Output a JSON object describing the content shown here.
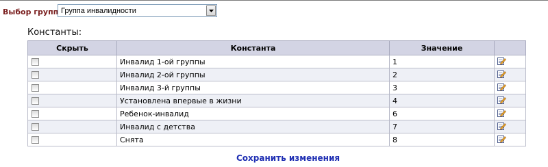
{
  "filter": {
    "label": "Выбор группы:",
    "selected": "Группа инвалидности"
  },
  "section_title": "Константы:",
  "table": {
    "headers": [
      "Скрыть",
      "Константа",
      "Значение",
      ""
    ],
    "rows": [
      {
        "name": "Инвалид 1-ой группы",
        "value": "1"
      },
      {
        "name": "Инвалид 2-ой группы",
        "value": "2"
      },
      {
        "name": "Инвалид 3-й группы",
        "value": "3"
      },
      {
        "name": "Установлена впервые в жизни",
        "value": "4"
      },
      {
        "name": "Ребенок-инвалид",
        "value": "6"
      },
      {
        "name": "Инвалид с детства",
        "value": "7"
      },
      {
        "name": "Снята",
        "value": "8"
      }
    ]
  },
  "save_label": "Сохранить изменения",
  "colors": {
    "header_bg": "#d3d4e4",
    "alt_row_bg": "#eef0f6",
    "label_color": "#7a1f1f",
    "link_color": "#1f2fb3"
  },
  "icons": {
    "row_action": "edit-icon",
    "select_arrow": "chevron-down-icon"
  }
}
